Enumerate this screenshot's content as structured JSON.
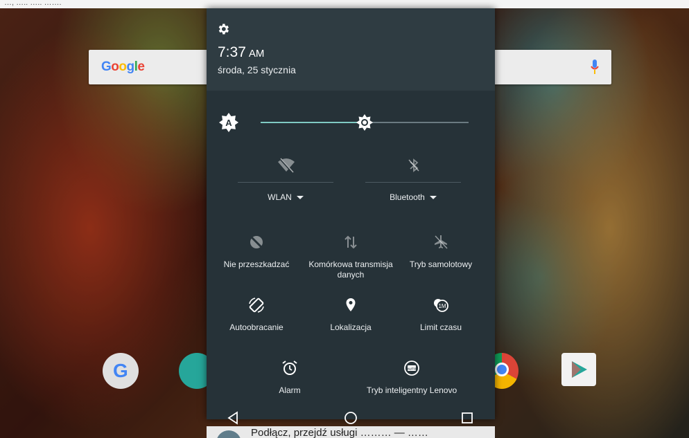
{
  "background": {
    "status_text": "…, ….. ….. …….",
    "search_bar": {
      "logo": "Google",
      "mic_icon": "mic-icon"
    },
    "dock_apps": [
      {
        "name": "google-app-icon"
      },
      {
        "name": "share-app-icon"
      },
      {
        "name": "chrome-app-icon"
      },
      {
        "name": "play-store-app-icon"
      }
    ],
    "bottom_notification_text": "Podłącz, przejdź usługi ……… — ……"
  },
  "shade": {
    "header": {
      "time": "7:37",
      "ampm": "AM",
      "date": "środa, 25 stycznia"
    },
    "brightness": {
      "level": 0.5,
      "auto": true
    },
    "primary_tiles": [
      {
        "label": "WLAN",
        "icon": "wifi-off-icon"
      },
      {
        "label": "Bluetooth",
        "icon": "bluetooth-off-icon"
      }
    ],
    "tiles": [
      {
        "label": "Nie przeszkadzać",
        "icon": "do-not-disturb-icon"
      },
      {
        "label": "Komórkowa transmisja danych",
        "icon": "mobile-data-icon"
      },
      {
        "label": "Tryb samolotowy",
        "icon": "airplane-icon"
      },
      {
        "label": "Autoobracanie",
        "icon": "auto-rotate-icon"
      },
      {
        "label": "Lokalizacja",
        "icon": "location-icon"
      },
      {
        "label": "Limit czasu",
        "icon": "screen-timeout-icon"
      },
      {
        "label": "Alarm",
        "icon": "alarm-icon"
      },
      {
        "label": "Tryb inteligentny Lenovo",
        "icon": "smart-mode-icon"
      }
    ],
    "nav": {
      "back": "back-icon",
      "home": "home-icon",
      "recents": "recents-icon"
    }
  },
  "colors": {
    "shade_bg": "#263238",
    "header_bg": "#2f3c42",
    "accent": "#80cbc4"
  }
}
